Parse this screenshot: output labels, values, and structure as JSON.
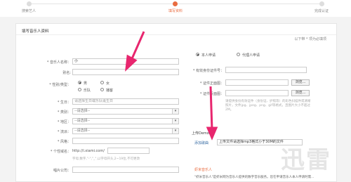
{
  "steps": [
    {
      "label": "搜索艺人",
      "active": false
    },
    {
      "label": "填写资料",
      "active": true
    },
    {
      "label": "完成认证",
      "active": false
    }
  ],
  "panel": {
    "title": "填写音乐人资料",
    "required_note": "以下带 * 项为必填项"
  },
  "form": {
    "name_label": "* 音乐人名称：",
    "name_value": "小",
    "alias_label": "别名:",
    "gender_label": "* 性别/类型：",
    "gender_options": [
      "男",
      "女",
      "乐队",
      "播客"
    ],
    "birthday_label": "* 生日：",
    "birthday_placeholder": "请选择生日或乐队诞生日",
    "type_label": "* 类别：",
    "type_value": "--请选择--",
    "region_label": "* 地区：",
    "region_value": "--请选择--",
    "genre_label": "* 流派：",
    "genre_value": "--请选择--",
    "style_label": "* 风格：",
    "domain_label": "* 个性域名：",
    "domain_value": "http://i.xiami.com/",
    "domain_hint": "字母,数字,\"-\",\"_\",以字母开头,2~19位,不可更改",
    "company_label": "唱片公司："
  },
  "right": {
    "apply_self": "本人申请",
    "apply_agent": "代理人申请",
    "id_label": "* 有效身份证件号：",
    "id_front_label": "* 证件正面图：",
    "id_back_label": "* 证件反面图：",
    "browse": "浏览...",
    "id_note": "请提供身份有效证件（身份证、护照等）的彩色扫描件或清晰照片，文件jpg、jpeg、png、gif等格式，且图片大小不超过2M。",
    "demo_label": "上传Demo",
    "add_song": "添加歌曲",
    "demo_note": "上传文件请选择mp3格式小于30M的文件",
    "new_section": "虾米音乐人",
    "new_desc": "\"虾米音乐人\"是虾米网为音乐人提供的数字音乐服务。您在申请音乐人本人申请时需..."
  },
  "watermark": "迅雷",
  "colors": {
    "accent": "#e96b3f",
    "arrow": "#e8266e"
  }
}
